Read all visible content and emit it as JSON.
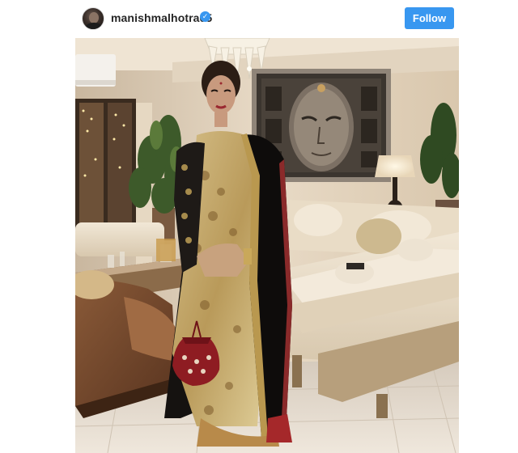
{
  "post": {
    "username": "manishmalhotra05",
    "verified": true,
    "follow_label": "Follow",
    "icons": {
      "avatar": "profile-avatar",
      "verified": "verified-badge-icon"
    },
    "photo": {
      "subject": "woman in embroidered gold and black anarkali with black dupatta holding a red potli bag",
      "setting": "living room with cream sofas, leather armchair, chandelier and large face painting"
    }
  },
  "colors": {
    "accent": "#3897f0",
    "text": "#262626"
  }
}
